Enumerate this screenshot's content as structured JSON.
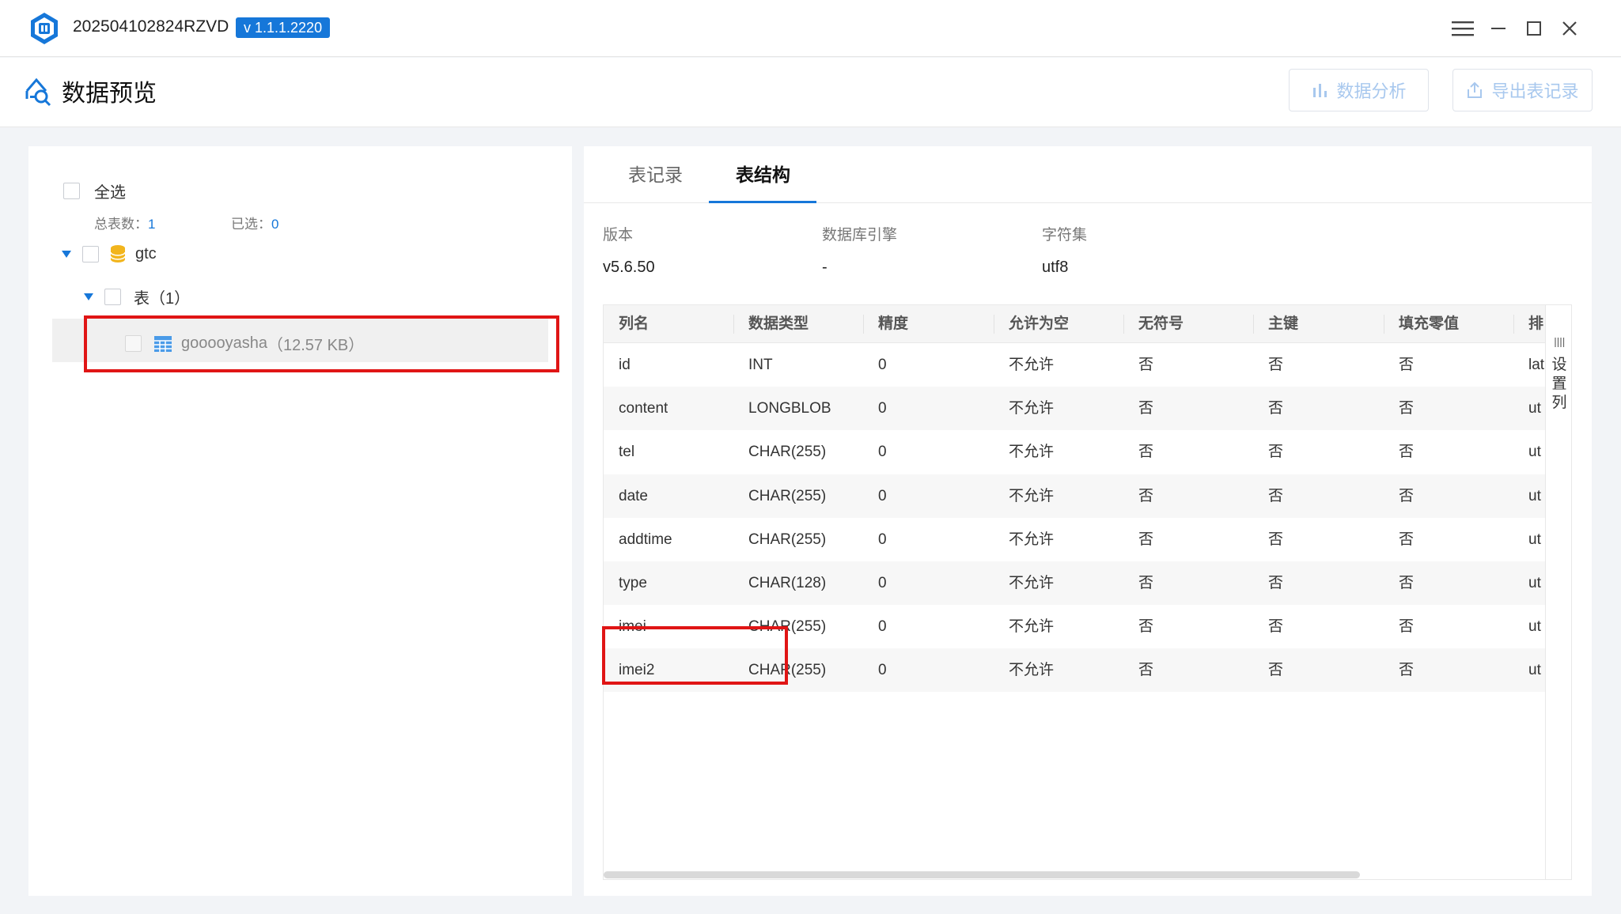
{
  "window": {
    "title": "202504102824RZVD",
    "version": "v 1.1.1.2220"
  },
  "header": {
    "title": "数据预览",
    "analyze_label": "数据分析",
    "export_label": "导出表记录"
  },
  "tree": {
    "select_all_label": "全选",
    "total_label": "总表数：",
    "total_value": "1",
    "selected_label": "已选：",
    "selected_value": "0",
    "db_name": "gtc",
    "group_label": "表（1）",
    "table_name": "gooooyasha",
    "table_size": "（12.57 KB）"
  },
  "tabs": [
    {
      "label": "表记录",
      "active": false
    },
    {
      "label": "表结构",
      "active": true
    }
  ],
  "meta": {
    "version_label": "版本",
    "version_value": "v5.6.50",
    "engine_label": "数据库引擎",
    "engine_value": "-",
    "charset_label": "字符集",
    "charset_value": "utf8"
  },
  "grid": {
    "columns": [
      "列名",
      "数据类型",
      "精度",
      "允许为空",
      "无符号",
      "主键",
      "填充零值",
      "排"
    ],
    "rows": [
      [
        "id",
        "INT",
        "0",
        "不允许",
        "否",
        "否",
        "否",
        "lat"
      ],
      [
        "content",
        "LONGBLOB",
        "0",
        "不允许",
        "否",
        "否",
        "否",
        "ut"
      ],
      [
        "tel",
        "CHAR(255)",
        "0",
        "不允许",
        "否",
        "否",
        "否",
        "ut"
      ],
      [
        "date",
        "CHAR(255)",
        "0",
        "不允许",
        "否",
        "否",
        "否",
        "ut"
      ],
      [
        "addtime",
        "CHAR(255)",
        "0",
        "不允许",
        "否",
        "否",
        "否",
        "ut"
      ],
      [
        "type",
        "CHAR(128)",
        "0",
        "不允许",
        "否",
        "否",
        "否",
        "ut"
      ],
      [
        "imei",
        "CHAR(255)",
        "0",
        "不允许",
        "否",
        "否",
        "否",
        "ut"
      ],
      [
        "imei2",
        "CHAR(255)",
        "0",
        "不允许",
        "否",
        "否",
        "否",
        "ut"
      ]
    ],
    "settings_label": "设置列"
  },
  "colors": {
    "accent": "#1677d9",
    "highlight": "#e01515"
  }
}
